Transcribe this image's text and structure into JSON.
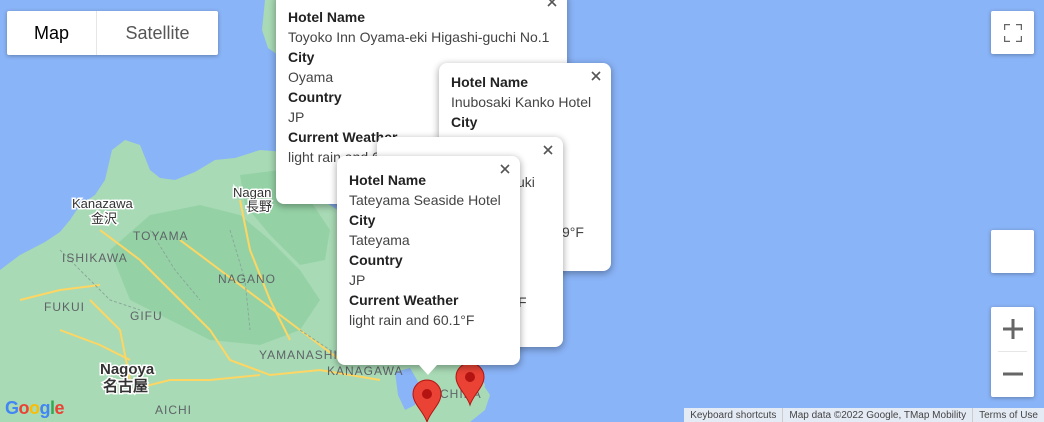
{
  "map_type": {
    "map_label": "Map",
    "satellite_label": "Satellite",
    "selected": "Map"
  },
  "place_labels": {
    "kanazawa_en": "Kanazawa",
    "kanazawa_jp": "金沢",
    "toyama": "TOYAMA",
    "ishikawa": "ISHIKAWA",
    "fukui": "FUKUI",
    "gifu": "GIFU",
    "nagano_pref": "NAGANO",
    "nagano_en": "Nagan",
    "nagano_jp": "長野",
    "yamanashi": "YAMANASHI",
    "kanagawa": "KANAGAWA",
    "aichi": "AICHI",
    "nagoya_en": "Nagoya",
    "nagoya_jp": "名古屋",
    "chiba_partial": "CHIBA"
  },
  "info_windows": [
    {
      "id": "oyama",
      "hotel_label": "Hotel Name",
      "hotel": "Toyoko Inn Oyama-eki Higashi-guchi No.1",
      "city_label": "City",
      "city": "Oyama",
      "country_label": "Country",
      "country": "JP",
      "weather_label": "Current Weather",
      "weather": "light rain and 6"
    },
    {
      "id": "inubosaki",
      "hotel_label": "Hotel Name",
      "hotel": "Inubosaki Kanko Hotel",
      "city_label": "City",
      "weather_partial": "9°F"
    },
    {
      "id": "kisarazu",
      "city_partial": "zuki",
      "weather_partial": "F"
    },
    {
      "id": "tateyama",
      "hotel_label": "Hotel Name",
      "hotel": "Tateyama Seaside Hotel",
      "city_label": "City",
      "city": "Tateyama",
      "country_label": "Country",
      "country": "JP",
      "weather_label": "Current Weather",
      "weather": "light rain and 60.1°F"
    }
  ],
  "attribution": {
    "keyboard": "Keyboard shortcuts",
    "map_data": "Map data ©2022 Google, TMap Mobility",
    "terms": "Terms of Use"
  },
  "logo": {
    "g1": "G",
    "o1": "o",
    "o2": "o",
    "g2": "g",
    "l": "l",
    "e": "e"
  },
  "icons": {
    "fullscreen": "fullscreen-icon",
    "zoom_in": "plus-icon",
    "zoom_out": "minus-icon",
    "close": "close-icon",
    "marker": "map-pin-icon"
  },
  "colors": {
    "water": "#8ab4f8",
    "land": "#a8dab5",
    "land_dark": "#94d2a5",
    "road": "#fdd663",
    "marker": "#ea4335",
    "google_blue": "#4285f4",
    "google_red": "#ea4335",
    "google_yellow": "#fbbc04",
    "google_green": "#34a853"
  }
}
